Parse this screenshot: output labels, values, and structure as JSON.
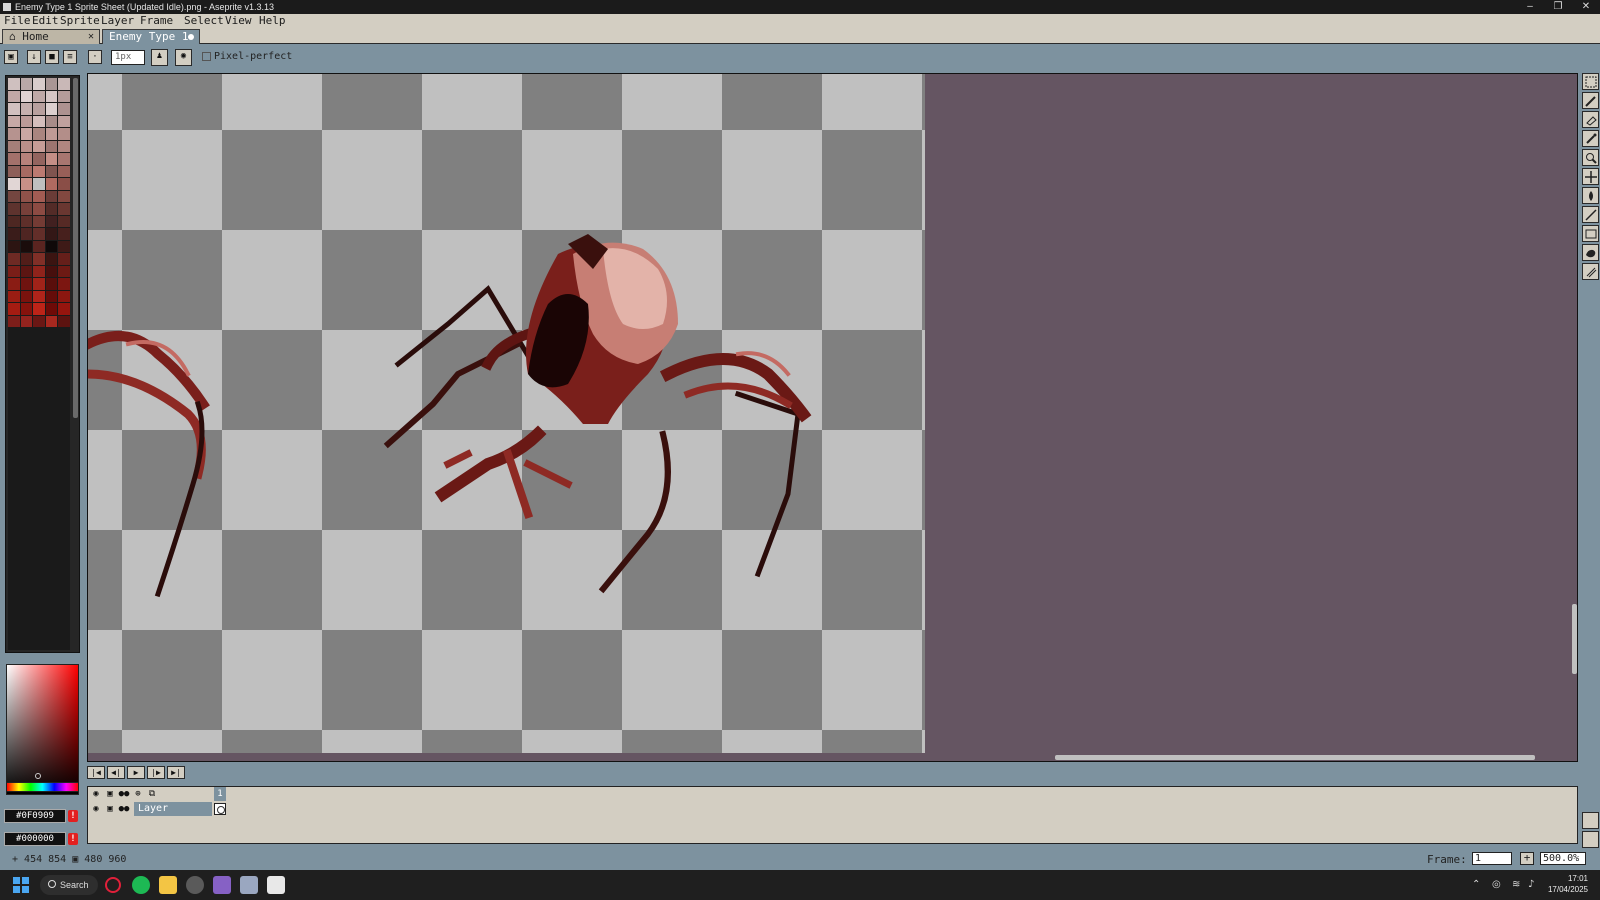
{
  "window": {
    "title": "Enemy Type 1 Sprite Sheet (Updated Idle).png - Aseprite v1.3.13"
  },
  "menu": [
    "File",
    "Edit",
    "Sprite",
    "Layer",
    "Frame",
    "Select",
    "View",
    "Help"
  ],
  "tabs": [
    {
      "label": "Home",
      "closable": true
    },
    {
      "label": "Enemy Type 1",
      "modified": true
    }
  ],
  "toolbar": {
    "brush_size": "1px",
    "pixel_perfect_label": "Pixel-perfect"
  },
  "colors": {
    "foreground": "#0F0909",
    "background": "#000000",
    "canvas_bg": "#655562",
    "accent": "#7d929f",
    "panel": "#d3cec2"
  },
  "palette": [
    "#cfc0bf",
    "#b9a9a8",
    "#d8cccb",
    "#a99695",
    "#c9b8b7",
    "#c2a8a6",
    "#e0d3d2",
    "#bfa9a7",
    "#d6c6c5",
    "#b49c9a",
    "#d2c0bf",
    "#c5b0ae",
    "#b8a09e",
    "#dccfce",
    "#ad9290",
    "#c7a9a6",
    "#bb9b98",
    "#d4bebc",
    "#a88c89",
    "#c0a19e",
    "#b6938f",
    "#caa7a3",
    "#a9857f",
    "#bf9a95",
    "#b38e89",
    "#a57f79",
    "#ba8f89",
    "#c79d97",
    "#9d7570",
    "#b08680",
    "#a3716b",
    "#b7827b",
    "#93645f",
    "#c48e86",
    "#a87670",
    "#8d5f59",
    "#a66a62",
    "#bc7a71",
    "#7f544f",
    "#985f58",
    "#e1d6d5",
    "#c89087",
    "#bfbfbf",
    "#b06a60",
    "#8a4e47",
    "#744640",
    "#8f524a",
    "#a35c53",
    "#6b3c37",
    "#824840",
    "#5e332e",
    "#77403a",
    "#8c4b43",
    "#532b27",
    "#6a3731",
    "#4d2722",
    "#5e2f2a",
    "#743b34",
    "#412020",
    "#562a25",
    "#3a1c1a",
    "#4f2522",
    "#632e29",
    "#331716",
    "#47201d",
    "#2c1412",
    "#1a0c0b",
    "#5a2420",
    "#0f0909",
    "#3e1a17",
    "#6e2a24",
    "#521d19",
    "#802f27",
    "#3b1411",
    "#651f1a",
    "#7a1e18",
    "#5c1512",
    "#8f231b",
    "#470f0d",
    "#6d1a14",
    "#8a1c14",
    "#6f130f",
    "#a12319",
    "#590e0b",
    "#7c1611",
    "#9a1d13",
    "#7a120d",
    "#b0241a",
    "#650c09",
    "#8c1710",
    "#a51c12",
    "#85120c",
    "#bd2418",
    "#6e0a07",
    "#96150e",
    "#7d1e1a",
    "#94231e",
    "#6a1714",
    "#a8281f",
    "#5c1310"
  ],
  "layer": {
    "name": "Layer",
    "frame_number": "1"
  },
  "status": {
    "cursor_pos": "454  854",
    "sprite_size": "480  960",
    "frame_label": "Frame:",
    "frame_value": "1",
    "zoom": "500.0%"
  },
  "taskbar": {
    "search_label": "Search",
    "time": "17:01",
    "date": "17/04/2025"
  }
}
